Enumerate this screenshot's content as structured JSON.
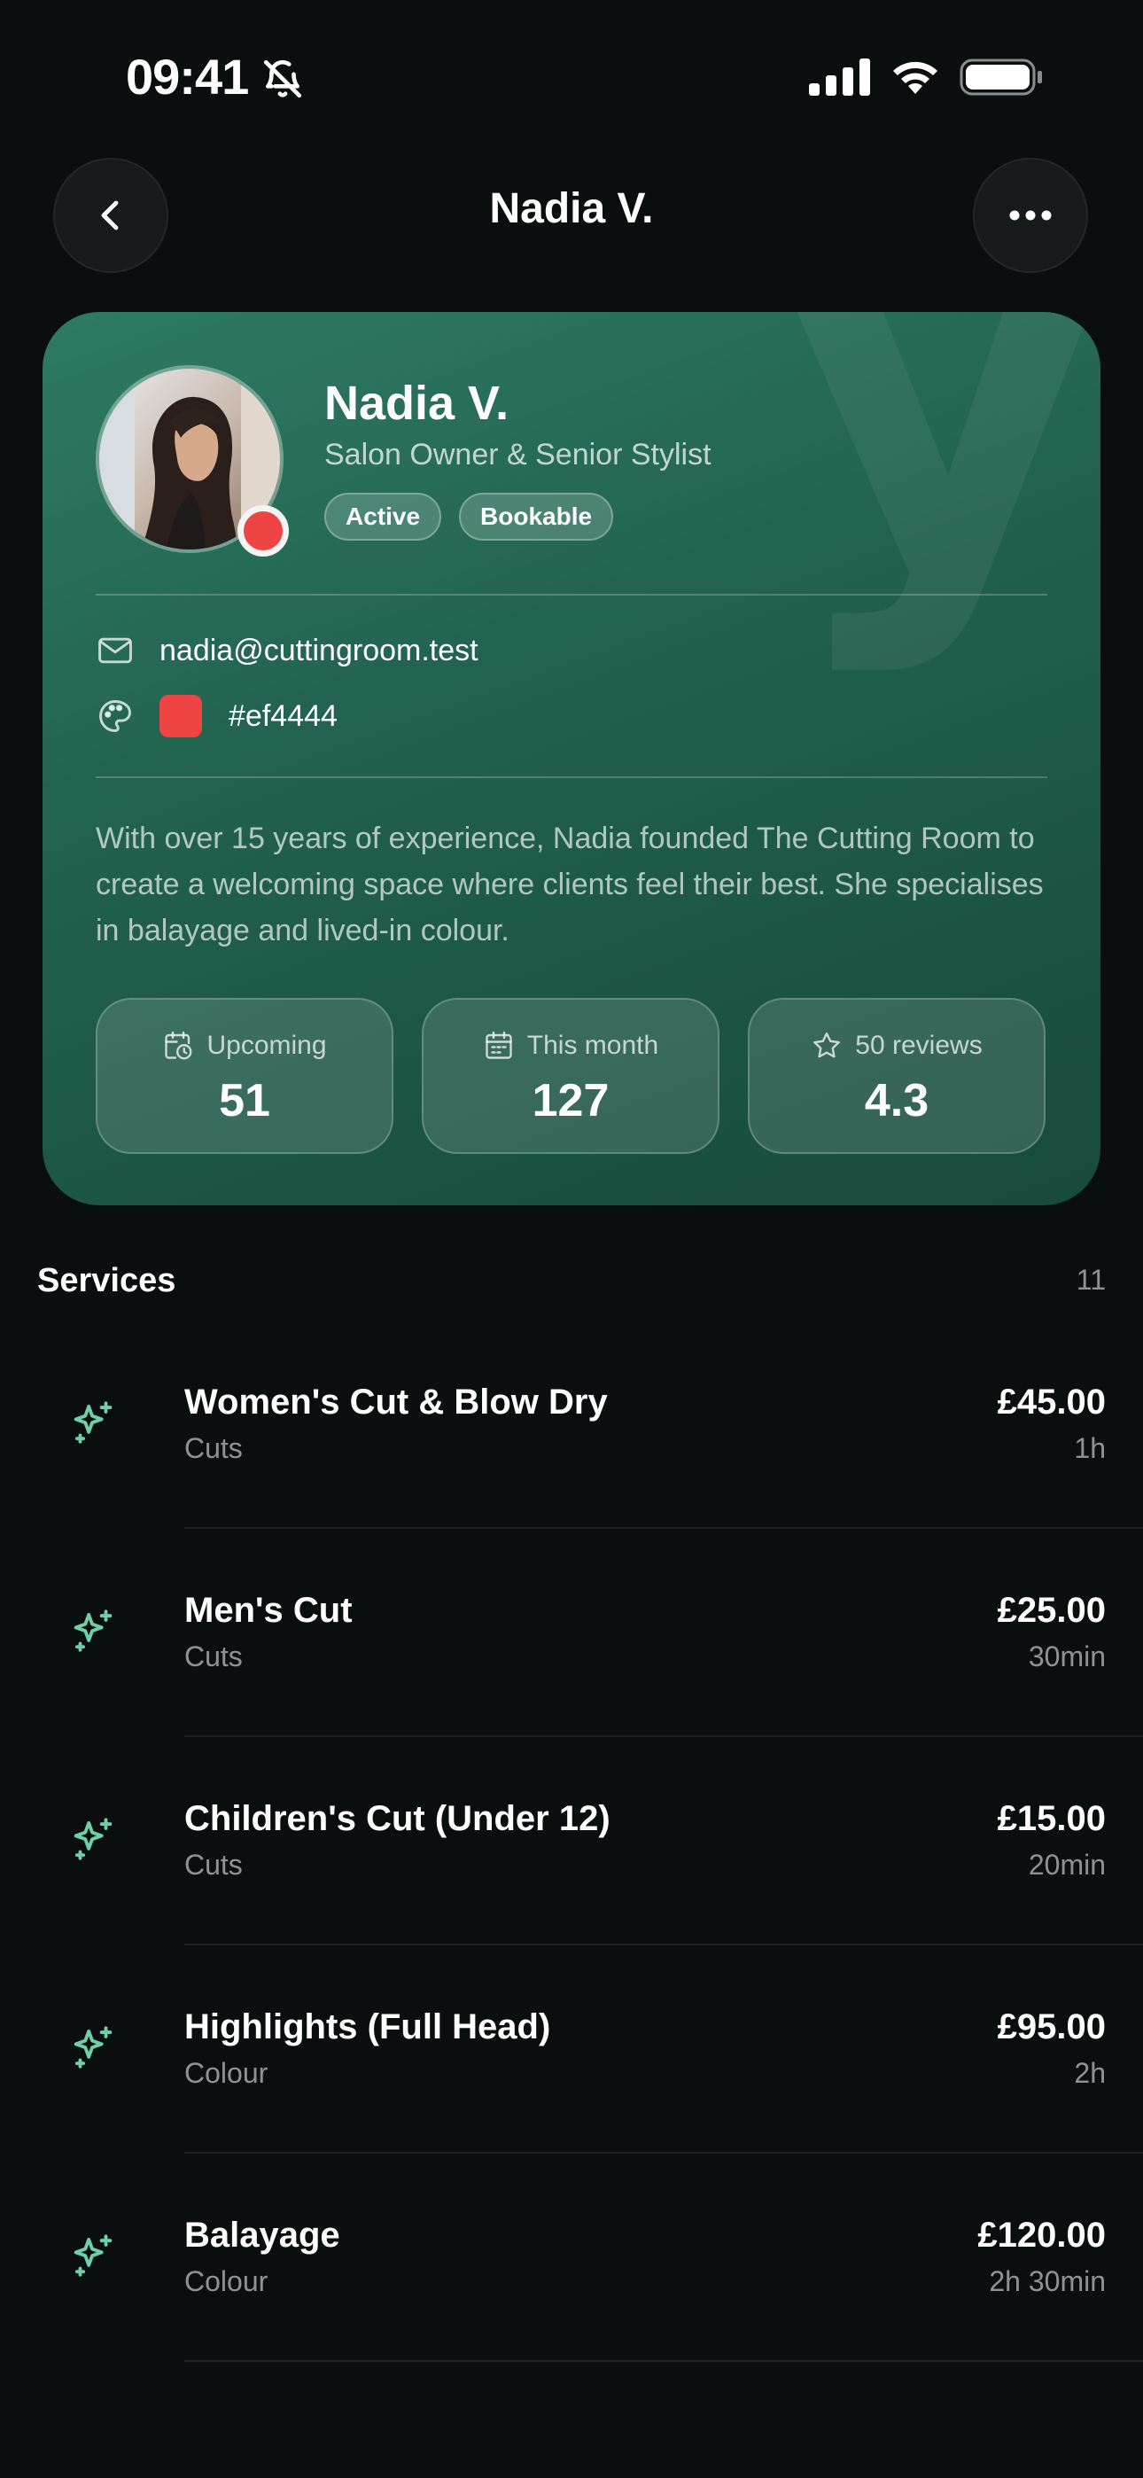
{
  "status_bar": {
    "time": "09:41",
    "icons": [
      "bell-slash-icon",
      "cellular-signal-icon",
      "wifi-icon",
      "battery-icon"
    ]
  },
  "header": {
    "title": "Nadia V.",
    "back_icon": "chevron-left-icon",
    "more_icon": "ellipsis-icon"
  },
  "profile": {
    "name": "Nadia V.",
    "role": "Salon Owner & Senior Stylist",
    "badges": [
      "Active",
      "Bookable"
    ],
    "watermark": "y",
    "status_color": "#ef4444",
    "email": "nadia@cuttingroom.test",
    "color_hex": "#ef4444",
    "bio": "With over 15 years of experience, Nadia founded The Cutting Room to create a welcoming space where clients feel their best. She specialises in balayage and lived-in colour.",
    "accent_color": "#2e7a63"
  },
  "stats": [
    {
      "icon": "calendar-clock-icon",
      "label": "Upcoming",
      "value": "51"
    },
    {
      "icon": "calendar-icon",
      "label": "This month",
      "value": "127"
    },
    {
      "icon": "star-icon",
      "label": "50 reviews",
      "value": "4.3"
    }
  ],
  "services": {
    "title": "Services",
    "count": "11",
    "icon": "sparkles-icon",
    "icon_color": "#6fcfaa",
    "items": [
      {
        "name": "Women's Cut & Blow Dry",
        "category": "Cuts",
        "price": "£45.00",
        "duration": "1h"
      },
      {
        "name": "Men's Cut",
        "category": "Cuts",
        "price": "£25.00",
        "duration": "30min"
      },
      {
        "name": "Children's Cut (Under 12)",
        "category": "Cuts",
        "price": "£15.00",
        "duration": "20min"
      },
      {
        "name": "Highlights (Full Head)",
        "category": "Colour",
        "price": "£95.00",
        "duration": "2h"
      },
      {
        "name": "Balayage",
        "category": "Colour",
        "price": "£120.00",
        "duration": "2h 30min"
      }
    ]
  }
}
